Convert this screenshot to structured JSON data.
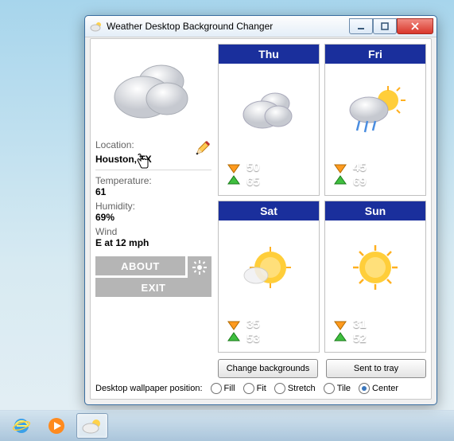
{
  "title": "Weather Desktop Background Changer",
  "current": {
    "location_label": "Location:",
    "location": "Houston, TX",
    "temp_label": "Temperature:",
    "temp": "61",
    "humidity_label": "Humidity:",
    "humidity": "69%",
    "wind_label": "Wind",
    "wind": "E at 12 mph"
  },
  "buttons": {
    "about": "ABOUT",
    "exit": "EXIT",
    "change_bg": "Change backgrounds",
    "sent_tray": "Sent to tray"
  },
  "forecast": [
    {
      "day": "Thu",
      "icon": "cloudy",
      "low": "50",
      "high": "65"
    },
    {
      "day": "Fri",
      "icon": "rain-sun",
      "low": "45",
      "high": "69"
    },
    {
      "day": "Sat",
      "icon": "partly-sun",
      "low": "35",
      "high": "53"
    },
    {
      "day": "Sun",
      "icon": "sunny",
      "low": "31",
      "high": "52"
    }
  ],
  "footer": {
    "label": "Desktop wallpaper position:",
    "options": [
      "Fill",
      "Fit",
      "Stretch",
      "Tile",
      "Center"
    ],
    "selected": "Center"
  }
}
